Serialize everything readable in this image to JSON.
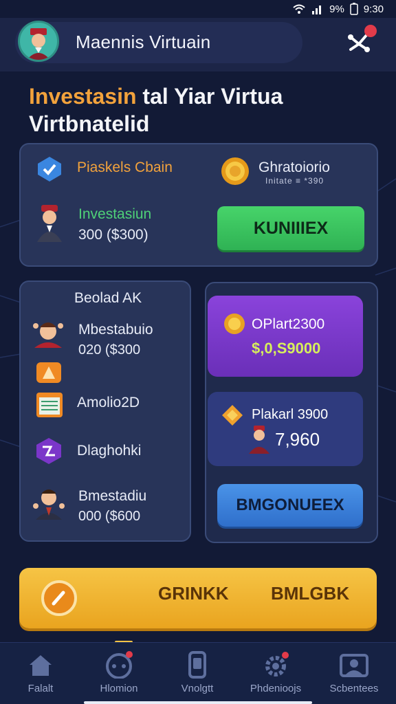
{
  "status_bar": {
    "time": "9:30",
    "battery": "9%"
  },
  "header": {
    "title": "Maennis Virtuain",
    "notification_count": ""
  },
  "heading": {
    "highlight": "Investasin",
    "line1_rest": " tal Yiar Virtua",
    "line2": "Virtbnatelid"
  },
  "top_card": {
    "chain_label": "Piaskels Cbain",
    "coin_label": "Ghratoiorio",
    "coin_sub": "Initate  ≡  *390",
    "invest_label": "Investasiun",
    "invest_amount": "300 ($300)",
    "button_label": "KUNIIIEX"
  },
  "left_card": {
    "title": "Beolad AK",
    "items": [
      {
        "label": "Mbestabuio",
        "sub": "020 ($300"
      },
      {
        "label": "Amolio2D",
        "sub": ""
      },
      {
        "label": "Dlaghohki",
        "sub": ""
      },
      {
        "label": "Bmestadiu",
        "sub": "000 ($600"
      }
    ]
  },
  "right_card": {
    "promo1": {
      "label": "OPlart2300",
      "value": "$,0,S9000"
    },
    "promo2": {
      "label": "Plakarl 3900",
      "value": "7,960"
    },
    "button_label": "BMGONUEEX"
  },
  "action_bar": {
    "left_label": "GRINKK",
    "right_label": "BMLGBK"
  },
  "bottom_nav": [
    {
      "label": "Falalt",
      "icon": "home-icon"
    },
    {
      "label": "Hlomion",
      "icon": "gamepad-icon"
    },
    {
      "label": "Vnolgtt",
      "icon": "phone-icon"
    },
    {
      "label": "Phdenioojs",
      "icon": "settings-icon"
    },
    {
      "label": "Scbentees",
      "icon": "profile-card-icon"
    }
  ],
  "colors": {
    "background": "#121a36",
    "card": "#283459",
    "accent_orange": "#f2a23c",
    "green": "#3ec25e",
    "purple": "#7b36c9",
    "blue": "#3a7fda",
    "yellow": "#f2b833"
  }
}
